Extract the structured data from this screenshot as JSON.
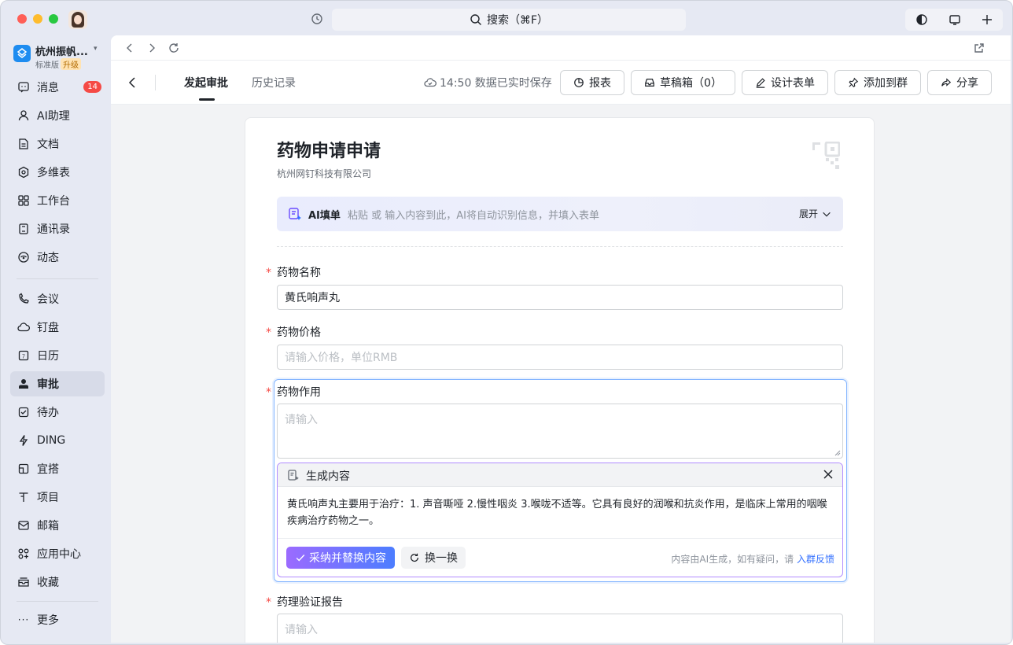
{
  "titlebar": {
    "search_placeholder": "搜索（⌘F）"
  },
  "sidebar": {
    "org_name": "杭州振帆...",
    "org_tier": "标准版",
    "org_upgrade": "升级",
    "items": [
      {
        "label": "消息",
        "icon": "message-icon",
        "badge": "14"
      },
      {
        "label": "AI助理",
        "icon": "ai-assistant-icon"
      },
      {
        "label": "文档",
        "icon": "document-icon"
      },
      {
        "label": "多维表",
        "icon": "table-icon"
      },
      {
        "label": "工作台",
        "icon": "workbench-icon"
      },
      {
        "label": "通讯录",
        "icon": "contacts-icon"
      },
      {
        "label": "动态",
        "icon": "feed-icon"
      },
      {
        "label": "会议",
        "icon": "meeting-icon"
      },
      {
        "label": "钉盘",
        "icon": "cloud-drive-icon"
      },
      {
        "label": "日历",
        "icon": "calendar-icon"
      },
      {
        "label": "审批",
        "icon": "approval-icon",
        "active": true
      },
      {
        "label": "待办",
        "icon": "todo-icon"
      },
      {
        "label": "DING",
        "icon": "ding-icon"
      },
      {
        "label": "宜搭",
        "icon": "yida-icon"
      },
      {
        "label": "项目",
        "icon": "project-icon"
      },
      {
        "label": "邮箱",
        "icon": "mail-icon"
      },
      {
        "label": "应用中心",
        "icon": "app-center-icon"
      },
      {
        "label": "收藏",
        "icon": "favorites-icon"
      }
    ],
    "more_label": "更多"
  },
  "header": {
    "tabs": [
      {
        "label": "发起审批",
        "active": true
      },
      {
        "label": "历史记录",
        "active": false
      }
    ],
    "saved_status": "14:50 数据已实时保存",
    "buttons": {
      "report": "报表",
      "drafts": "草稿箱（0）",
      "design": "设计表单",
      "add_group": "添加到群",
      "share": "分享"
    }
  },
  "form": {
    "title": "药物申请申请",
    "company": "杭州网钉科技有限公司",
    "ai_fill": {
      "title": "AI填单",
      "hint": "粘贴 或 输入内容到此，AI将自动识别信息，并填入表单",
      "expand": "展开"
    },
    "fields": {
      "name": {
        "label": "药物名称",
        "value": "黄氏响声丸"
      },
      "price": {
        "label": "药物价格",
        "placeholder": "请输入价格，单位RMB"
      },
      "effect": {
        "label": "药物作用",
        "placeholder": "请输入"
      },
      "report": {
        "label": "药理验证报告",
        "placeholder": "请输入"
      }
    },
    "required_mark": "*",
    "generated": {
      "title": "生成内容",
      "text": "黄氏响声丸主要用于治疗：1. 声音嘶哑 2.慢性咽炎 3.喉咙不适等。它具有良好的润喉和抗炎作用，是临床上常用的咽喉疾病治疗药物之一。",
      "accept": "采纳并替换内容",
      "swap": "换一换",
      "footer_text": "内容由AI生成，如有疑问，请",
      "footer_link": "入群反馈"
    }
  },
  "colors": {
    "accent": "#3370ff",
    "required": "#f54a45",
    "badge": "#f54a45"
  }
}
